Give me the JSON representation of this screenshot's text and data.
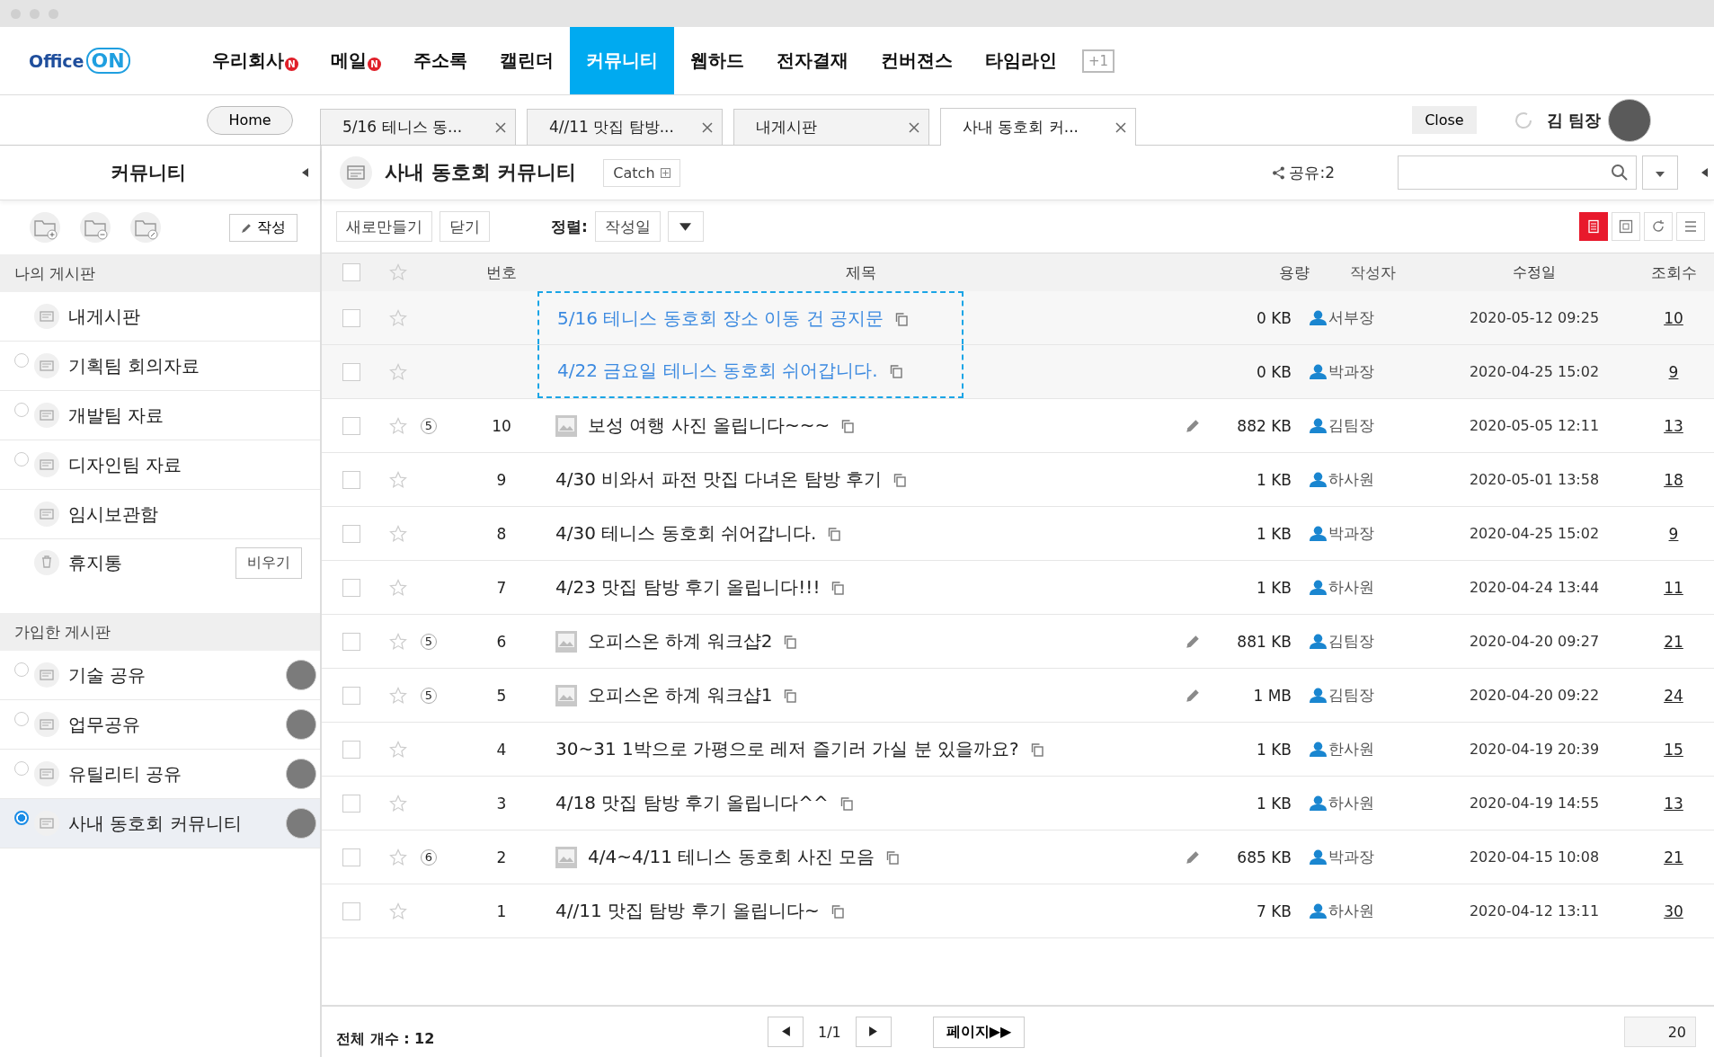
{
  "logo": {
    "text": "Office",
    "mark": "ON"
  },
  "nav": [
    {
      "label": "우리회사",
      "badge": "N",
      "selected": false
    },
    {
      "label": "메일",
      "badge": "N",
      "selected": false
    },
    {
      "label": "주소록",
      "selected": false
    },
    {
      "label": "캘린더",
      "selected": false
    },
    {
      "label": "커뮤니티",
      "selected": true
    },
    {
      "label": "웹하드",
      "selected": false
    },
    {
      "label": "전자결재",
      "selected": false
    },
    {
      "label": "컨버젼스",
      "selected": false
    },
    {
      "label": "타임라인",
      "selected": false
    }
  ],
  "nav_more": "+1",
  "home_button": "Home",
  "tabs": [
    {
      "label": "5/16 테니스 동...",
      "selected": false
    },
    {
      "label": "4//11 맛집 탐방...",
      "selected": false
    },
    {
      "label": "내게시판",
      "selected": false
    },
    {
      "label": "사내 동호회 커...",
      "selected": true
    }
  ],
  "close_button": "Close",
  "user": {
    "name": "김 팀장"
  },
  "sidebar": {
    "title": "커뮤니티",
    "write_button": "작성",
    "sections": [
      {
        "title": "나의 게시판",
        "items": [
          {
            "label": "내게시판",
            "kind": "plain",
            "selected": false
          },
          {
            "label": "기획팀 회의자료",
            "kind": "radio",
            "selected": false
          },
          {
            "label": "개발팀 자료",
            "kind": "radio",
            "selected": false
          },
          {
            "label": "디자인팀 자료",
            "kind": "radio",
            "selected": false
          },
          {
            "label": "임시보관함",
            "kind": "plain",
            "selected": false
          },
          {
            "label": "휴지통",
            "kind": "trash",
            "selected": false,
            "action": "비우기"
          }
        ]
      },
      {
        "title": "가입한 게시판",
        "items": [
          {
            "label": "기술 공유",
            "kind": "joined",
            "selected": false
          },
          {
            "label": "업무공유",
            "kind": "joined",
            "selected": false
          },
          {
            "label": "유틸리티 공유",
            "kind": "joined",
            "selected": false
          },
          {
            "label": "사내 동호회 커뮤니티",
            "kind": "joined",
            "selected": true
          }
        ]
      }
    ]
  },
  "board": {
    "title": "사내 동호회 커뮤니티",
    "catch_button": "Catch",
    "share": "공유:2"
  },
  "toolbar": {
    "new_button": "새로만들기",
    "close_button": "닫기",
    "sort_label": "정렬:",
    "sort_value": "작성일"
  },
  "views": [
    {
      "kind": "list",
      "selected": true
    },
    {
      "kind": "card",
      "selected": false
    },
    {
      "kind": "refresh",
      "selected": false
    },
    {
      "kind": "menu",
      "selected": false
    }
  ],
  "table": {
    "select_all_checked": false,
    "columns": [
      "번호",
      "제목",
      "용량",
      "작성자",
      "수정일",
      "조회수"
    ],
    "rows": [
      {
        "kind": "notice",
        "checked": false,
        "title": "5/16 테니스 동호회 장소 이동 건 공지문",
        "size": "0 KB",
        "author": "서부장",
        "date": "2020-05-12 09:25",
        "views": "10"
      },
      {
        "kind": "notice",
        "checked": false,
        "title": "4/22 금요일 테니스 동호회 쉬어갑니다.",
        "size": "0 KB",
        "author": "박과장",
        "date": "2020-04-25 15:02",
        "views": "9"
      },
      {
        "kind": "post",
        "checked": false,
        "number": "10",
        "attachments": "5",
        "image": true,
        "edited": true,
        "title": "보성 여행 사진 올립니다~~~",
        "size": "882 KB",
        "author": "김팀장",
        "date": "2020-05-05 12:11",
        "views": "13"
      },
      {
        "kind": "post",
        "checked": false,
        "number": "9",
        "image": false,
        "edited": false,
        "title": "4/30 비와서 파전 맛집 다녀온 탐방 후기",
        "size": "1 KB",
        "author": "하사원",
        "date": "2020-05-01 13:58",
        "views": "18"
      },
      {
        "kind": "post",
        "checked": false,
        "number": "8",
        "image": false,
        "edited": false,
        "title": "4/30 테니스 동호회 쉬어갑니다.",
        "size": "1 KB",
        "author": "박과장",
        "date": "2020-04-25 15:02",
        "views": "9"
      },
      {
        "kind": "post",
        "checked": false,
        "number": "7",
        "image": false,
        "edited": false,
        "title": "4/23 맛집 탐방 후기 올립니다!!!",
        "size": "1 KB",
        "author": "하사원",
        "date": "2020-04-24 13:44",
        "views": "11"
      },
      {
        "kind": "post",
        "checked": false,
        "number": "6",
        "attachments": "5",
        "image": true,
        "edited": true,
        "title": "오피스온 하계 워크샵2",
        "size": "881 KB",
        "author": "김팀장",
        "date": "2020-04-20 09:27",
        "views": "21"
      },
      {
        "kind": "post",
        "checked": false,
        "number": "5",
        "attachments": "5",
        "image": true,
        "edited": true,
        "title": "오피스온 하계 워크샵1",
        "size": "1 MB",
        "author": "김팀장",
        "date": "2020-04-20 09:22",
        "views": "24"
      },
      {
        "kind": "post",
        "checked": false,
        "number": "4",
        "image": false,
        "edited": false,
        "title": "30~31 1박으로 가평으로 레저 즐기러 가실 분 있을까요?",
        "size": "1 KB",
        "author": "한사원",
        "date": "2020-04-19 20:39",
        "views": "15"
      },
      {
        "kind": "post",
        "checked": false,
        "number": "3",
        "image": false,
        "edited": false,
        "title": "4/18 맛집 탐방 후기 올립니다^^",
        "size": "1 KB",
        "author": "하사원",
        "date": "2020-04-19 14:55",
        "views": "13"
      },
      {
        "kind": "post",
        "checked": false,
        "number": "2",
        "attachments": "6",
        "image": true,
        "edited": true,
        "title": "4/4~4/11 테니스 동호회 사진 모음",
        "size": "685 KB",
        "author": "박과장",
        "date": "2020-04-15 10:08",
        "views": "21"
      },
      {
        "kind": "post",
        "checked": false,
        "number": "1",
        "image": false,
        "edited": false,
        "title": "4//11 맛집 탐방 후기 올립니다~",
        "size": "7 KB",
        "author": "하사원",
        "date": "2020-04-12 13:11",
        "views": "30"
      }
    ]
  },
  "footer": {
    "total": "전체 개수 : 12",
    "page": "1/1",
    "page_button": "페이지▶▶",
    "page_size": "20"
  }
}
